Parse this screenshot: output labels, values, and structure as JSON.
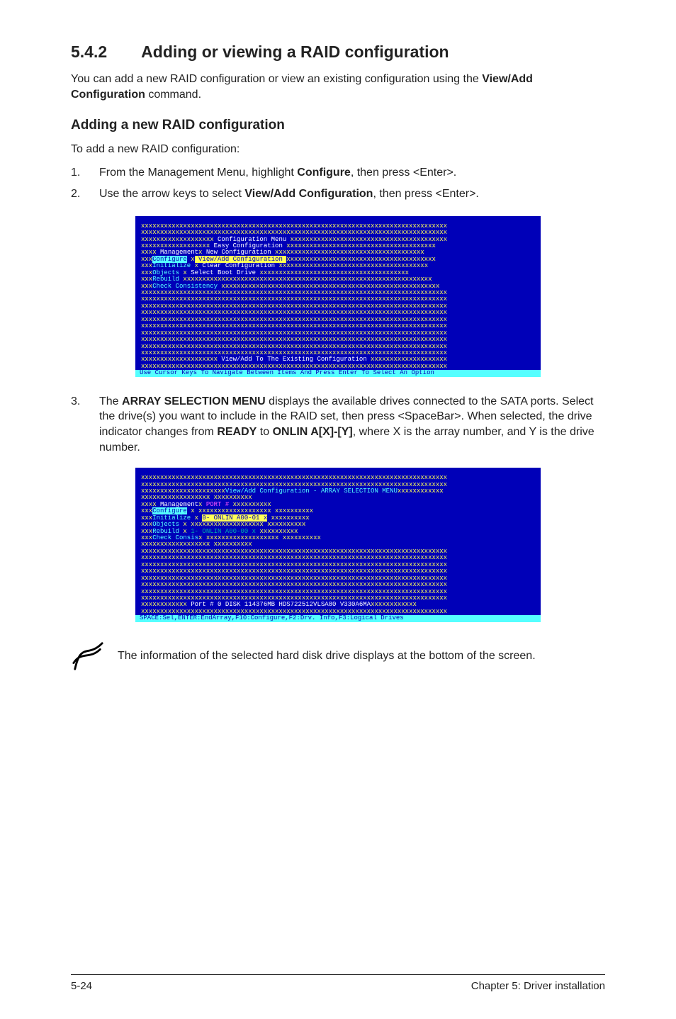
{
  "section": {
    "number": "5.4.2",
    "title": "Adding or viewing a RAID configuration"
  },
  "intro": {
    "l1a": "You can add a new RAID configuration or view an existing configuration using the ",
    "bold": "View/Add Configuration",
    "l1b": " command."
  },
  "subhead": "Adding a new RAID configuration",
  "lead": "To add a new RAID configuration:",
  "steps": [
    {
      "idx": "1.",
      "pre": "From the Management Menu, highlight ",
      "b": "Configure",
      "post": ", then press <Enter>."
    },
    {
      "idx": "2.",
      "pre": "Use the arrow keys to select ",
      "b": "View/Add Configuration",
      "post": ", then press <Enter>."
    }
  ],
  "screen1": {
    "row_fill": "xxxxxxxxxxxxxxxxxxxxxxxxxxxxxxxxxxxxxxxxxxxxxxxxxxxxxxxxxxxxxxxxxxxxxxxxxxxxxxxx",
    "title_pre": "xxxxxxxxxxxxxxxxxxx",
    "title": " Configuration Menu ",
    "title_post": "xxxxxxxxxxxxxxxxxxxxxxxxxxxxxxxxxxxxxxxxx",
    "easy_pre": "xxxxxxxxxxxxxxxxxx ",
    "easy": "Easy Configuration",
    "easy_post": "    xxxxxxxxxxxxxxxxxxxxxxxxxxxxxxxxxxxxxxx",
    "mgmt_pre": "xxxx ",
    "mgmt": "Management",
    "newcfg": " New Configuration",
    "newcfg_post": "     xxxxxxxxxxxxxxxxxxxxxxxxxxxxxxxxxxxxxxx",
    "conf_pre": "xxx",
    "conf": "Configure",
    "viewadd": " View/Add Configuration ",
    "viewadd_post": "xxxxxxxxxxxxxxxxxxxxxxxxxxxxxxxxxxxxxxx",
    "init_pre": "xxx",
    "init": "Initialize",
    "clear": " Clear Configuration",
    "clear_post": "   xxxxxxxxxxxxxxxxxxxxxxxxxxxxxxxxxxxxxxx",
    "obj_pre": "xxx",
    "obj": "Objects",
    "boot": " Select Boot Drive",
    "boot_post": "     xxxxxxxxxxxxxxxxxxxxxxxxxxxxxxxxxxxxxxx",
    "reb_pre": "xxx",
    "reb": "Rebuild",
    "reb_post": "    xxxxxxxxxxxxxxxxxxxxxxxxxxxxxxxxxxxxxxxxxxxxxxxxxxxxxxxxxxxxxxxxx",
    "chk_pre": "xxx",
    "chk": "Check Consistency",
    "chk_post": "   xxxxxxxxxxxxxxxxxxxxxxxxxxxxxxxxxxxxxxxxxxxxxxxxxxxxxxxxx",
    "msg_pre": "xxxxxxxxxxxxxxxxxxxx ",
    "msg": "View/Add To The Existing Configuration",
    "msg_post": " xxxxxxxxxxxxxxxxxxxx",
    "status": " Use Cursor Keys To Navigate Between Items And Press Enter To Select An Option "
  },
  "step3": {
    "idx": "3.",
    "t1": "The ",
    "b1": "ARRAY SELECTION MENU",
    "t2": " displays the available drives connected to the SATA ports. Select the drive(s) you want to include in the RAID set, then press <SpaceBar>. When selected, the drive indicator changes from ",
    "b2": "READY",
    "t3": "  to ",
    "b3": "ONLIN A[X]-[Y]",
    "t4": ", where X is the array number, and Y is the drive number."
  },
  "screen2": {
    "row_fill": "xxxxxxxxxxxxxxxxxxxxxxxxxxxxxxxxxxxxxxxxxxxxxxxxxxxxxxxxxxxxxxxxxxxxxxxxxxxxxxxx",
    "title_pre": "xxxxxxxxxxxxxxxxxxxxxx",
    "title": "View/Add Configuration - ARRAY SELECTION MENU",
    "title_post": "xxxxxxxxxxxx",
    "side_fill_l": "xxxxxxxxxxxxxxxxxx",
    "port": "PORT #",
    "side_fill_r": "xxxxxxxxxx",
    "mgmt_pre": "xxxx ",
    "mgmt": "Management",
    "conf_pre": "xxx",
    "conf": "Configure",
    "init_pre": "xxx",
    "init": "Initialize",
    "line0": " 0- ONLIN A00-01 x",
    "obj_pre": "xxx",
    "obj": "Objects",
    "reb_pre": "xxx",
    "reb": "Rebuild",
    "line1": " 1- ONLIN A00-00 x",
    "chk_pre": "xxx",
    "chk": "Check Consis",
    "info_pre": "xxxxxxxxxxxx ",
    "info": "Port # 0  DISK   114376MB  HDS722512VLSA80    V330A6MA",
    "info_post": "xxxxxxxxxxxx",
    "status": " SPACE:Sel,ENTER:EndArray,F10:Configure,F2:Drv. Info,F3:Logical Drives "
  },
  "note": "The information of the selected hard disk drive displays at the bottom of the screen.",
  "footer": {
    "left": "5-24",
    "right": "Chapter 5: Driver installation"
  }
}
